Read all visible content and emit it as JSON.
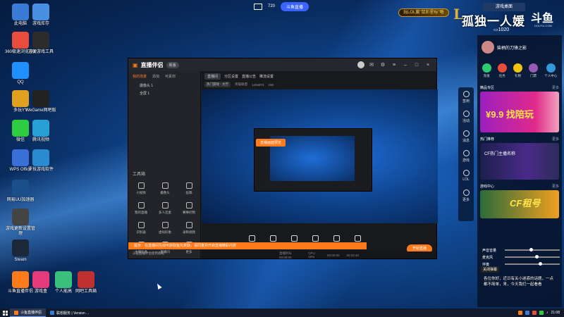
{
  "desktop": {
    "icons": [
      {
        "label": "此电脑",
        "color": "#3a7bd5"
      },
      {
        "label": "游戏库存",
        "color": "#4a90e2"
      },
      {
        "label": "360极速浏览器X",
        "color": "#e94b3c"
      },
      {
        "label": "方便游戏工具",
        "color": "#2c2c2c"
      },
      {
        "label": "QQ",
        "color": "#1e90ff"
      },
      {
        "label": "多玩YY",
        "color": "#e0a020"
      },
      {
        "label": "WeGame网吧版",
        "color": "#222"
      },
      {
        "label": "微信",
        "color": "#2ecc40"
      },
      {
        "label": "腾讯视频",
        "color": "#27a0d8"
      },
      {
        "label": "WPS Office",
        "color": "#3a6fd8"
      },
      {
        "label": "罗技游戏软件",
        "color": "#2a8bd0"
      },
      {
        "label": "网易UU加速器",
        "color": "#1a4f8a"
      },
      {
        "label": "游戏更新设置管理",
        "color": "#444"
      },
      {
        "label": "Steam",
        "color": "#1b2838"
      },
      {
        "label": "斗鱼直播伴侣",
        "color": "#ff7a1a"
      },
      {
        "label": "游戏盒",
        "color": "#e63b7a"
      },
      {
        "label": "个人能高",
        "color": "#3ac07a"
      },
      {
        "label": "网吧工具箱",
        "color": "#c03030"
      }
    ]
  },
  "stream_overlay": {
    "fps": "720",
    "pill": "斗鱼直播",
    "lol_badge": "玩LOL赢\"鼠彩星标\"咯",
    "streamer_title": "孤独一人媛",
    "douyu_logo": "斗鱼",
    "douyu_sub": "DOUYU.COM",
    "room_id": "1020",
    "tutorial_tab": "游戏桌面"
  },
  "app": {
    "logo": "直播伴侣",
    "version": "新版",
    "left_tabs": [
      "我的场景",
      "添加",
      "可素材"
    ],
    "scenes": [
      "摄像头 1",
      "全屏 1"
    ],
    "tools_label": "工具箱",
    "tools": [
      "小视频",
      "摄像头",
      "投稿",
      "我的直播",
      "多人连麦",
      "赛事控制",
      "识别器",
      "虚拟形象",
      "录制视频",
      "主播任务",
      "直播间",
      "更多"
    ],
    "bottom_left": "斗鱼直播伴侣使用教程",
    "main_tabs": [
      "直播间",
      "分区设置",
      "直播公告",
      "推流设置"
    ],
    "main_sub": [
      "热门游戏 · 大厅",
      "英雄联盟",
      "1434974",
      "150"
    ],
    "toolbar": [
      {
        "label": "直播画面"
      },
      {
        "label": "摄像头"
      },
      {
        "label": "手机投屏"
      },
      {
        "label": "多媒体"
      },
      {
        "label": "麦克风"
      },
      {
        "label": "扬声器"
      }
    ],
    "live_button": "开始直播",
    "orange_banner": "提示：在直播间互动可获取鱼丸奖励，请同意并开启直播精彩内容",
    "preview_hint": "直播画面预览",
    "status_items": [
      "直播时长 00:00:00",
      "CPU 15%",
      "00:00:00",
      "00:02:40"
    ]
  },
  "douyu_panel": {
    "user_name": "柴柄的刀锋之影",
    "quick_actions": [
      {
        "label": "充值",
        "color": "#2ecc71"
      },
      {
        "label": "任务",
        "color": "#e74c3c"
      },
      {
        "label": "礼物",
        "color": "#f1c40f"
      },
      {
        "label": "门票",
        "color": "#9b59b6"
      },
      {
        "label": "个人中心",
        "color": "#3498db"
      }
    ],
    "section1_title": "精品专区",
    "section1_more": "更多",
    "promo_text": "¥9.9 找陪玩",
    "section2_title": "热门推荐",
    "section2_more": "更多",
    "lol_card_text": "CF热门主播名称",
    "section3_title": "游戏中心",
    "section3_more": "更多",
    "game_card_text": "CF租号"
  },
  "side_nav": [
    "签到",
    "活动",
    "消息",
    "游戏",
    "LOL",
    "更多"
  ],
  "sliders": [
    {
      "label": "声音音量",
      "value": 0.45
    },
    {
      "label": "麦克风",
      "value": 0.55
    },
    {
      "label": "伴奏",
      "value": 0.62
    }
  ],
  "pinned_label": "关闭弹幕",
  "subtitle": "各位你好，近日有关小迷惑的话题，一点都不简单，来，今天我们一起看看",
  "taskbar": {
    "tasks": [
      {
        "label": "斗鱼直播伴侣",
        "color": "#ff7a1a",
        "active": true
      },
      {
        "label": "联想服务 | Version ...",
        "color": "#3a7bd5",
        "active": false
      }
    ],
    "time": "21:08"
  }
}
